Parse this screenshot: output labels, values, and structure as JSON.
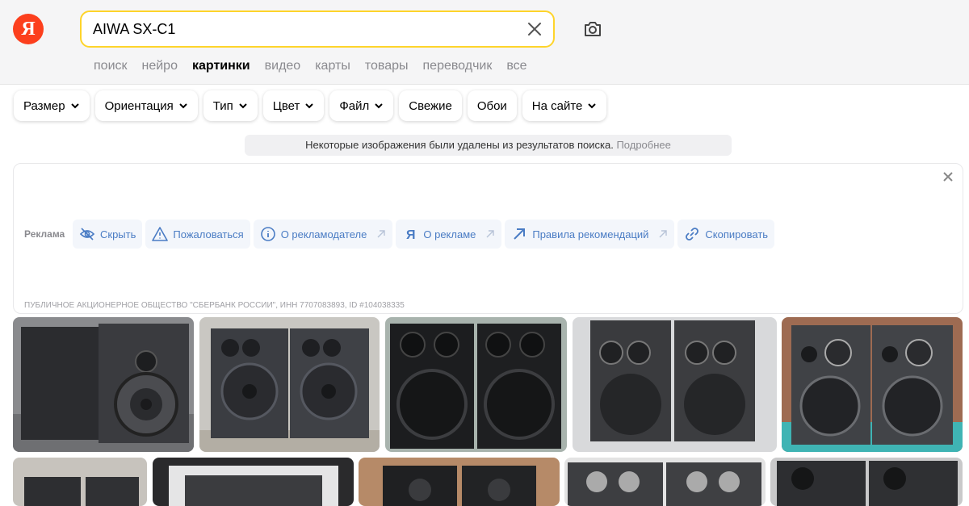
{
  "logo": {
    "letter": "Я"
  },
  "search": {
    "query": "AIWA SX-C1"
  },
  "tabs": [
    {
      "label": "поиск"
    },
    {
      "label": "нейро"
    },
    {
      "label": "картинки",
      "active": true
    },
    {
      "label": "видео"
    },
    {
      "label": "карты"
    },
    {
      "label": "товары"
    },
    {
      "label": "переводчик"
    },
    {
      "label": "все"
    }
  ],
  "filters": [
    {
      "label": "Размер",
      "dropdown": true
    },
    {
      "label": "Ориентация",
      "dropdown": true
    },
    {
      "label": "Тип",
      "dropdown": true
    },
    {
      "label": "Цвет",
      "dropdown": true
    },
    {
      "label": "Файл",
      "dropdown": true
    },
    {
      "label": "Свежие",
      "dropdown": false
    },
    {
      "label": "Обои",
      "dropdown": false
    },
    {
      "label": "На сайте",
      "dropdown": true
    }
  ],
  "notice": {
    "text": "Некоторые изображения были удалены из результатов поиска.",
    "more": "Подробнее"
  },
  "ad": {
    "label": "Реклама",
    "actions": {
      "hide": "Скрыть",
      "report": "Пожаловаться",
      "advertiser": "О рекламодателе",
      "about": "О рекламе",
      "rules": "Правила рекомендаций",
      "copy": "Скопировать"
    },
    "legal": "ПУБЛИЧНОЕ АКЦИОНЕРНОЕ ОБЩЕСТВО \"СБЕРБАНК РОССИИ\", ИНН 7707083893, ID #104038335"
  },
  "colors": {
    "logo_red": "#fc3f1d",
    "search_border": "#fed42b",
    "ad_link": "#4a7cc4"
  },
  "icons": {
    "clear": "close-icon",
    "camera": "camera-icon",
    "chevron": "chevron-down-icon"
  }
}
